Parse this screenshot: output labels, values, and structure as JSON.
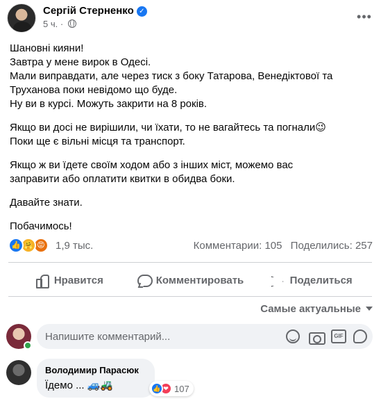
{
  "post": {
    "author": "Сергій Стерненко",
    "time": "5 ч.",
    "verified_symbol": "✓",
    "more_symbol": "•••",
    "text": {
      "p1": [
        "Шановні кияни!",
        "Завтра у мене вирок в Одесі.",
        "Мали виправдати, але через тиск з боку Татарова, Венедіктової та",
        "Труханова поки невідомо що буде.",
        "Ну ви в курсі. Можуть закрити на 8 років."
      ],
      "p2": [
        "Якщо ви досі не вирішили, чи їхати, то не вагайтесь та погнали😉",
        "Поки ще є вільні місця та транспорт."
      ],
      "p3": [
        "Якщо ж ви їдете своїм ходом або з інших міст, можемо вас",
        "заправити або оплатити квитки в обидва боки."
      ],
      "p4": "Давайте знати.",
      "p5": "Побачимось!"
    }
  },
  "reactions": {
    "icons": [
      "like-icon",
      "care-icon",
      "angry-icon"
    ],
    "count": "1,9 тыс.",
    "comments": "Комментарии: 105",
    "shares": "Поделились: 257"
  },
  "actions": {
    "like": "Нравится",
    "comment": "Комментировать",
    "share": "Поделиться"
  },
  "sort": {
    "label": "Самые актуальные"
  },
  "composer": {
    "placeholder": "Напишите комментарий...",
    "gif_label": "GIF"
  },
  "comment": {
    "author": "Володимир Парасюк",
    "text": "Їдемо ... 🚙🚜",
    "reaction_icons": [
      "like-icon",
      "love-icon"
    ],
    "reaction_count": "107"
  },
  "colors": {
    "accent": "#1877f2",
    "secondary_text": "#65676b",
    "bubble_bg": "#f0f2f5",
    "online": "#31a24c"
  }
}
